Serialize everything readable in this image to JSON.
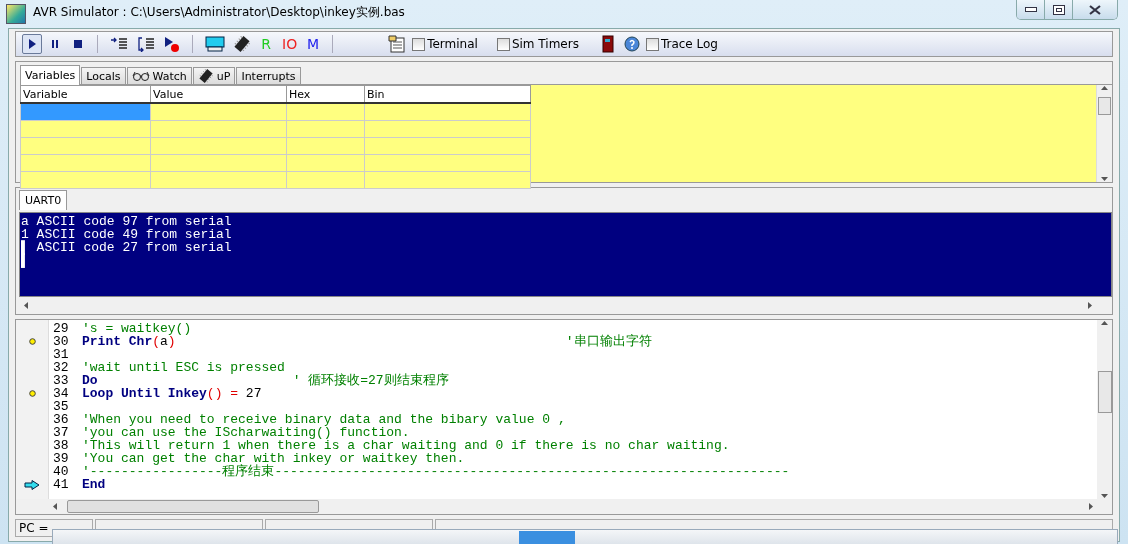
{
  "window": {
    "title": "AVR Simulator : C:\\Users\\Administrator\\Desktop\\inkey实例.bas"
  },
  "toolbar": [
    {
      "kind": "run",
      "pressed": true
    },
    {
      "kind": "pause",
      "pressed": false
    },
    {
      "kind": "stop",
      "pressed": false
    },
    {
      "kind": "sep"
    },
    {
      "kind": "step-into",
      "pressed": false
    },
    {
      "kind": "step-over",
      "pressed": false
    },
    {
      "kind": "breakpoint",
      "pressed": false
    },
    {
      "kind": "sep"
    },
    {
      "kind": "lcd",
      "pressed": false
    },
    {
      "kind": "chip",
      "pressed": false
    },
    {
      "kind": "letter",
      "text": "R",
      "color": "#22cc22",
      "pressed": false
    },
    {
      "kind": "letter",
      "text": "IO",
      "color": "#ee2222",
      "pressed": false
    },
    {
      "kind": "letter",
      "text": "M",
      "color": "#2222ee",
      "pressed": false
    },
    {
      "kind": "sep"
    },
    {
      "kind": "terminal",
      "pressed": false
    },
    {
      "kind": "checkbox",
      "label": "Terminal",
      "checked": false
    },
    {
      "kind": "checkbox",
      "label": "Sim Timers",
      "checked": false
    },
    {
      "kind": "door",
      "pressed": false
    },
    {
      "kind": "help",
      "pressed": false
    },
    {
      "kind": "checkbox",
      "label": "Trace Log",
      "checked": false
    }
  ],
  "tabs": [
    {
      "kind": "text",
      "label": "Variables",
      "selected": true
    },
    {
      "kind": "text",
      "label": "Locals",
      "selected": false
    },
    {
      "kind": "glasses",
      "label": "Watch",
      "selected": false
    },
    {
      "kind": "chip",
      "label": "uP",
      "selected": false
    },
    {
      "kind": "text",
      "label": "Interrupts",
      "selected": false
    }
  ],
  "variables": {
    "columns": [
      "Variable",
      "Value",
      "Hex",
      "Bin"
    ],
    "rows": [
      {
        "selected": true
      },
      {
        "selected": false
      },
      {
        "selected": false
      },
      {
        "selected": false
      },
      {
        "selected": false
      }
    ]
  },
  "uart": {
    "tabs": [
      {
        "label": "UART0",
        "selected": true
      }
    ],
    "lines": [
      "a ASCII code 97 from serial",
      "1 ASCII code 49 from serial",
      "▌ ASCII code 27 from serial",
      "▌"
    ]
  },
  "code": [
    {
      "number": "29",
      "breakpoint": false,
      "current": false,
      "segments": [
        {
          "kind": "comment",
          "text": "'s = waitkey()"
        }
      ]
    },
    {
      "number": "30",
      "breakpoint": true,
      "current": false,
      "segments": [
        {
          "kind": "keyword",
          "text": "Print Chr"
        },
        {
          "kind": "paren",
          "text": "("
        },
        {
          "kind": "plain",
          "text": "a"
        },
        {
          "kind": "paren",
          "text": ")"
        },
        {
          "kind": "comment",
          "text": "                                                  '串口输出字符"
        }
      ]
    },
    {
      "number": "31",
      "breakpoint": false,
      "current": false
    },
    {
      "number": "32",
      "breakpoint": false,
      "current": false,
      "segments": [
        {
          "kind": "comment",
          "text": "'wait until ESC is pressed"
        }
      ]
    },
    {
      "number": "33",
      "breakpoint": false,
      "current": false,
      "segments": [
        {
          "kind": "keyword",
          "text": "Do"
        },
        {
          "kind": "comment",
          "text": "                         ' 循环接收=27则结束程序"
        }
      ]
    },
    {
      "number": "34",
      "breakpoint": true,
      "current": false,
      "segments": [
        {
          "kind": "keyword",
          "text": "Loop Until Inkey"
        },
        {
          "kind": "paren",
          "text": "() ="
        },
        {
          "kind": "plain",
          "text": " 27"
        }
      ]
    },
    {
      "number": "35",
      "breakpoint": false,
      "current": false
    },
    {
      "number": "36",
      "breakpoint": false,
      "current": false,
      "segments": [
        {
          "kind": "comment",
          "text": "'When you need to receive binary data and the bibary value 0 ,"
        }
      ]
    },
    {
      "number": "37",
      "breakpoint": false,
      "current": false,
      "segments": [
        {
          "kind": "comment",
          "text": "'you can use the IScharwaiting() function."
        }
      ]
    },
    {
      "number": "38",
      "breakpoint": false,
      "current": false,
      "segments": [
        {
          "kind": "comment",
          "text": "'This will return 1 when there is a char waiting and 0 if there is no char waiting."
        }
      ]
    },
    {
      "number": "39",
      "breakpoint": false,
      "current": false,
      "segments": [
        {
          "kind": "comment",
          "text": "'You can get the char with inkey or waitkey then."
        }
      ]
    },
    {
      "number": "40",
      "breakpoint": false,
      "current": false,
      "segments": [
        {
          "kind": "comment",
          "text": "'-----------------程序结束------------------------------------------------------------------"
        }
      ]
    },
    {
      "number": "41",
      "breakpoint": false,
      "current": true,
      "segments": [
        {
          "kind": "keyword",
          "text": "End"
        }
      ]
    }
  ],
  "status_bar": [
    "PC ="
  ]
}
